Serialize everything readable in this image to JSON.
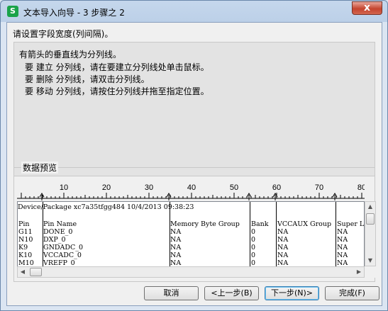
{
  "window": {
    "title": "文本导入向导 - 3 步骤之 2",
    "app_icon": "S",
    "close_label": "x"
  },
  "prompt": "请设置字段宽度(列间隔)。",
  "instructions": {
    "heading": "有箭头的垂直线为分列线。",
    "lines": [
      "要 建立 分列线，请在要建立分列线处单击鼠标。",
      "要 删除 分列线，请双击分列线。",
      "要 移动 分列线，请按住分列线并拖至指定位置。"
    ]
  },
  "preview": {
    "label": "数据预览",
    "ruler_labels": [
      "10",
      "20",
      "30",
      "40",
      "50",
      "60",
      "70",
      "80"
    ],
    "title_line": "Device/Package xc7a35tfgg484 10/4/2013 09:38:23",
    "headers": [
      "Pin",
      "Pin Name",
      "Memory Byte Group",
      "Bank",
      "VCCAUX Group",
      "Super L"
    ],
    "rows": [
      [
        "G11",
        "DONE_0",
        "NA",
        "0",
        "NA",
        "NA"
      ],
      [
        "N10",
        "DXP_0",
        "NA",
        "0",
        "NA",
        "NA"
      ],
      [
        "K9",
        "GNDADC_0",
        "NA",
        "0",
        "NA",
        "NA"
      ],
      [
        "K10",
        "VCCADC_0",
        "NA",
        "0",
        "NA",
        "NA"
      ],
      [
        "M10",
        "VREFP_0",
        "NA",
        "0",
        "NA",
        "NA"
      ]
    ]
  },
  "buttons": {
    "cancel": "取消",
    "back": "<上一步(B)",
    "next": "下一步(N)>",
    "finish": "完成(F)"
  }
}
